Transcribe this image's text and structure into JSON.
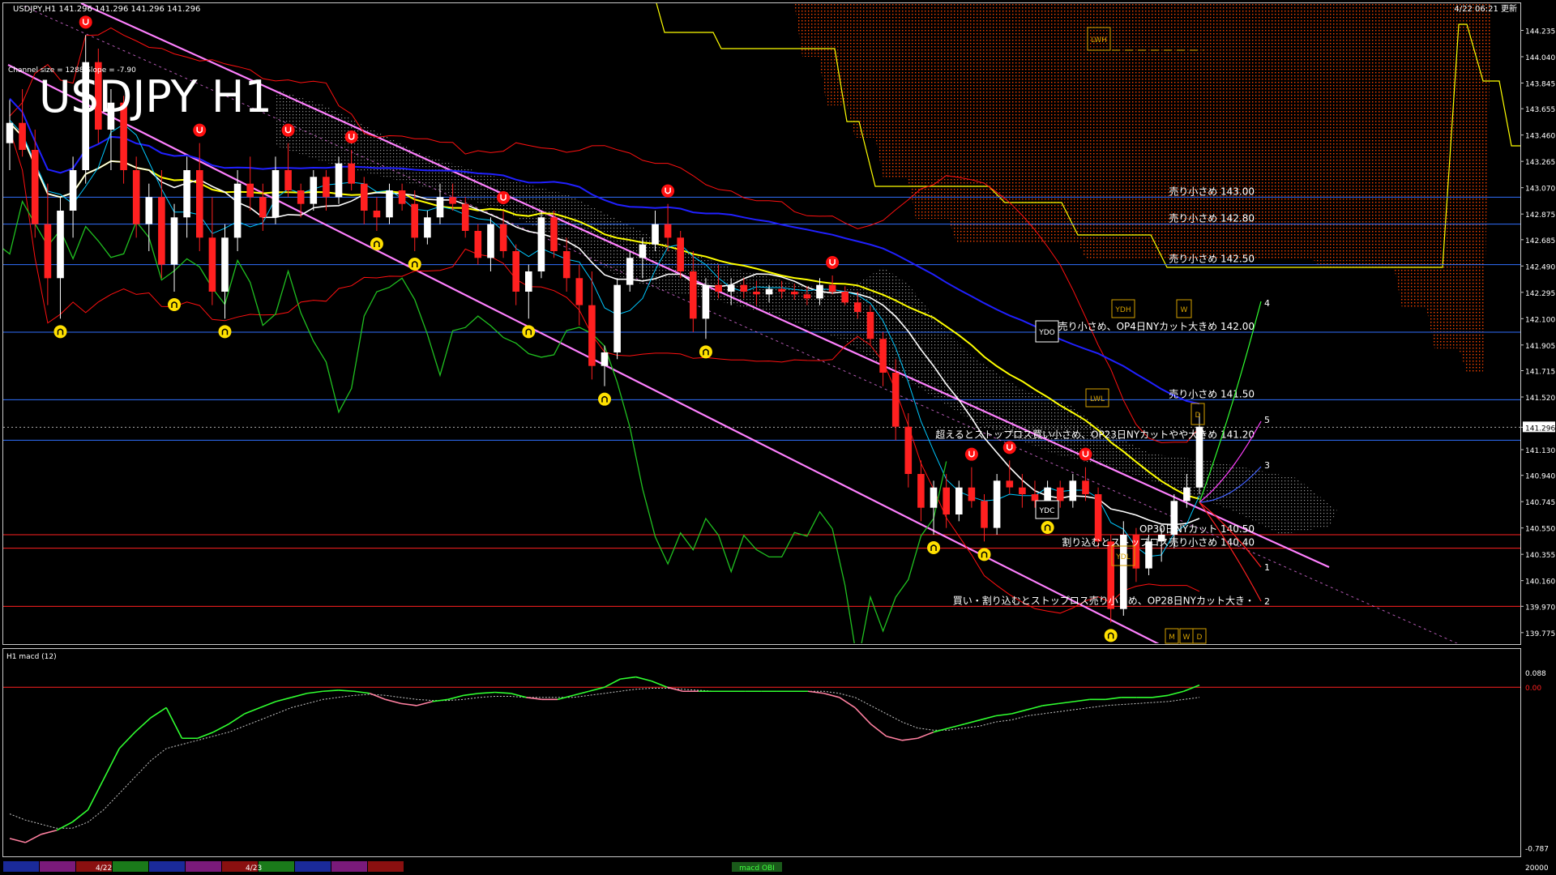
{
  "header": {
    "symbol_line": "USDJPY,H1  141.296 141.296 141.296 141.296",
    "channel_info": "Channel size = 1288 Slope = -7.90",
    "big_title": "USDJPY H1",
    "update_time": "4/22 06:21 更新"
  },
  "subwindow": {
    "label": "H1  macd (12)",
    "indicator_tag": "macd OBI"
  },
  "bottom_bar": {
    "date_labels": [
      "4/22",
      "4/23"
    ]
  },
  "colors": {
    "background": "#000000",
    "frame": "#c8c8c8",
    "bull_candle": "#ffffff",
    "bear_candle": "#ff2020",
    "channel": "#ff80ff",
    "ma_yellow": "#ffff00",
    "ma_white": "#ffffff",
    "ma_blue": "#2020ff",
    "bollinger": "#ff1010",
    "lagging_span": "#20c020",
    "cloud": "#ff4400",
    "level_blue": "#3070ff",
    "level_red": "#ff2020",
    "macd_line": "#30ff30",
    "macd_signal": "#c8c8c8"
  },
  "chart_data": {
    "type": "candlestick",
    "symbol": "USDJPY",
    "timeframe": "H1",
    "last_price": 141.296,
    "y_axis_ticks": [
      "144.235",
      "144.040",
      "143.845",
      "143.655",
      "143.460",
      "143.265",
      "143.070",
      "142.875",
      "142.685",
      "142.490",
      "142.295",
      "142.100",
      "141.905",
      "141.715",
      "141.520",
      "141.296",
      "141.130",
      "140.940",
      "140.745",
      "140.550",
      "140.355",
      "140.160",
      "139.970",
      "139.775"
    ],
    "ylim": [
      139.72,
      144.4
    ],
    "macd_axis_ticks": [
      "0.088",
      "0.00",
      "-0.787"
    ],
    "macd_scale_bottom": "20000",
    "candles": [
      {
        "o": 143.4,
        "h": 143.72,
        "l": 143.2,
        "c": 143.55
      },
      {
        "o": 143.55,
        "h": 143.8,
        "l": 143.3,
        "c": 143.35
      },
      {
        "o": 143.35,
        "h": 143.5,
        "l": 142.7,
        "c": 142.8
      },
      {
        "o": 142.8,
        "h": 143.1,
        "l": 142.2,
        "c": 142.4
      },
      {
        "o": 142.4,
        "h": 143.0,
        "l": 142.1,
        "c": 142.9
      },
      {
        "o": 142.9,
        "h": 143.3,
        "l": 142.7,
        "c": 143.2
      },
      {
        "o": 143.2,
        "h": 144.2,
        "l": 143.1,
        "c": 144.0
      },
      {
        "o": 144.0,
        "h": 144.1,
        "l": 143.4,
        "c": 143.5
      },
      {
        "o": 143.5,
        "h": 143.8,
        "l": 143.2,
        "c": 143.7
      },
      {
        "o": 143.7,
        "h": 143.75,
        "l": 143.1,
        "c": 143.2
      },
      {
        "o": 143.2,
        "h": 143.3,
        "l": 142.7,
        "c": 142.8
      },
      {
        "o": 142.8,
        "h": 143.1,
        "l": 142.6,
        "c": 143.0
      },
      {
        "o": 143.0,
        "h": 143.2,
        "l": 142.4,
        "c": 142.5
      },
      {
        "o": 142.5,
        "h": 142.95,
        "l": 142.3,
        "c": 142.85
      },
      {
        "o": 142.85,
        "h": 143.3,
        "l": 142.7,
        "c": 143.2
      },
      {
        "o": 143.2,
        "h": 143.4,
        "l": 142.6,
        "c": 142.7
      },
      {
        "o": 142.7,
        "h": 143.0,
        "l": 142.2,
        "c": 142.3
      },
      {
        "o": 142.3,
        "h": 142.8,
        "l": 142.1,
        "c": 142.7
      },
      {
        "o": 142.7,
        "h": 143.2,
        "l": 142.6,
        "c": 143.1
      },
      {
        "o": 143.1,
        "h": 143.3,
        "l": 142.9,
        "c": 143.0
      },
      {
        "o": 143.0,
        "h": 143.1,
        "l": 142.75,
        "c": 142.85
      },
      {
        "o": 142.85,
        "h": 143.3,
        "l": 142.8,
        "c": 143.2
      },
      {
        "o": 143.2,
        "h": 143.4,
        "l": 143.0,
        "c": 143.05
      },
      {
        "o": 143.05,
        "h": 143.1,
        "l": 142.85,
        "c": 142.95
      },
      {
        "o": 142.95,
        "h": 143.2,
        "l": 142.9,
        "c": 143.15
      },
      {
        "o": 143.15,
        "h": 143.2,
        "l": 142.9,
        "c": 143.0
      },
      {
        "o": 143.0,
        "h": 143.3,
        "l": 142.95,
        "c": 143.25
      },
      {
        "o": 143.25,
        "h": 143.35,
        "l": 143.05,
        "c": 143.1
      },
      {
        "o": 143.1,
        "h": 143.15,
        "l": 142.8,
        "c": 142.9
      },
      {
        "o": 142.9,
        "h": 143.0,
        "l": 142.75,
        "c": 142.85
      },
      {
        "o": 142.85,
        "h": 143.1,
        "l": 142.8,
        "c": 143.05
      },
      {
        "o": 143.05,
        "h": 143.1,
        "l": 142.9,
        "c": 142.95
      },
      {
        "o": 142.95,
        "h": 143.05,
        "l": 142.6,
        "c": 142.7
      },
      {
        "o": 142.7,
        "h": 142.9,
        "l": 142.65,
        "c": 142.85
      },
      {
        "o": 142.85,
        "h": 143.1,
        "l": 142.8,
        "c": 143.0
      },
      {
        "o": 143.0,
        "h": 143.1,
        "l": 142.9,
        "c": 142.95
      },
      {
        "o": 142.95,
        "h": 143.0,
        "l": 142.7,
        "c": 142.75
      },
      {
        "o": 142.75,
        "h": 142.8,
        "l": 142.5,
        "c": 142.55
      },
      {
        "o": 142.55,
        "h": 142.85,
        "l": 142.45,
        "c": 142.8
      },
      {
        "o": 142.8,
        "h": 142.9,
        "l": 142.55,
        "c": 142.6
      },
      {
        "o": 142.6,
        "h": 142.65,
        "l": 142.2,
        "c": 142.3
      },
      {
        "o": 142.3,
        "h": 142.5,
        "l": 142.1,
        "c": 142.45
      },
      {
        "o": 142.45,
        "h": 142.9,
        "l": 142.4,
        "c": 142.85
      },
      {
        "o": 142.85,
        "h": 142.9,
        "l": 142.55,
        "c": 142.6
      },
      {
        "o": 142.6,
        "h": 142.7,
        "l": 142.3,
        "c": 142.4
      },
      {
        "o": 142.4,
        "h": 142.5,
        "l": 142.05,
        "c": 142.2
      },
      {
        "o": 142.2,
        "h": 142.45,
        "l": 141.65,
        "c": 141.75
      },
      {
        "o": 141.75,
        "h": 141.9,
        "l": 141.6,
        "c": 141.85
      },
      {
        "o": 141.85,
        "h": 142.4,
        "l": 141.8,
        "c": 142.35
      },
      {
        "o": 142.35,
        "h": 142.6,
        "l": 142.3,
        "c": 142.55
      },
      {
        "o": 142.55,
        "h": 142.7,
        "l": 142.4,
        "c": 142.65
      },
      {
        "o": 142.65,
        "h": 142.9,
        "l": 142.6,
        "c": 142.8
      },
      {
        "o": 142.8,
        "h": 142.95,
        "l": 142.6,
        "c": 142.7
      },
      {
        "o": 142.7,
        "h": 142.75,
        "l": 142.4,
        "c": 142.45
      },
      {
        "o": 142.45,
        "h": 142.6,
        "l": 142.0,
        "c": 142.1
      },
      {
        "o": 142.1,
        "h": 142.4,
        "l": 141.95,
        "c": 142.35
      },
      {
        "o": 142.35,
        "h": 142.5,
        "l": 142.25,
        "c": 142.3
      },
      {
        "o": 142.3,
        "h": 142.4,
        "l": 142.2,
        "c": 142.35
      },
      {
        "o": 142.35,
        "h": 142.4,
        "l": 142.25,
        "c": 142.3
      },
      {
        "o": 142.3,
        "h": 142.38,
        "l": 142.2,
        "c": 142.28
      },
      {
        "o": 142.28,
        "h": 142.35,
        "l": 142.22,
        "c": 142.32
      },
      {
        "o": 142.32,
        "h": 142.38,
        "l": 142.25,
        "c": 142.3
      },
      {
        "o": 142.3,
        "h": 142.36,
        "l": 142.24,
        "c": 142.28
      },
      {
        "o": 142.28,
        "h": 142.34,
        "l": 142.2,
        "c": 142.25
      },
      {
        "o": 142.25,
        "h": 142.4,
        "l": 142.2,
        "c": 142.35
      },
      {
        "o": 142.35,
        "h": 142.42,
        "l": 142.28,
        "c": 142.3
      },
      {
        "o": 142.3,
        "h": 142.34,
        "l": 142.2,
        "c": 142.22
      },
      {
        "o": 142.22,
        "h": 142.3,
        "l": 142.1,
        "c": 142.15
      },
      {
        "o": 142.15,
        "h": 142.2,
        "l": 141.9,
        "c": 141.95
      },
      {
        "o": 141.95,
        "h": 142.0,
        "l": 141.6,
        "c": 141.7
      },
      {
        "o": 141.7,
        "h": 141.8,
        "l": 141.2,
        "c": 141.3
      },
      {
        "o": 141.3,
        "h": 141.4,
        "l": 140.85,
        "c": 140.95
      },
      {
        "o": 140.95,
        "h": 141.05,
        "l": 140.6,
        "c": 140.7
      },
      {
        "o": 140.7,
        "h": 140.9,
        "l": 140.5,
        "c": 140.85
      },
      {
        "o": 140.85,
        "h": 140.95,
        "l": 140.55,
        "c": 140.65
      },
      {
        "o": 140.65,
        "h": 140.9,
        "l": 140.6,
        "c": 140.85
      },
      {
        "o": 140.85,
        "h": 141.0,
        "l": 140.7,
        "c": 140.75
      },
      {
        "o": 140.75,
        "h": 140.8,
        "l": 140.45,
        "c": 140.55
      },
      {
        "o": 140.55,
        "h": 140.95,
        "l": 140.5,
        "c": 140.9
      },
      {
        "o": 140.9,
        "h": 141.05,
        "l": 140.8,
        "c": 140.85
      },
      {
        "o": 140.85,
        "h": 140.95,
        "l": 140.7,
        "c": 140.8
      },
      {
        "o": 140.8,
        "h": 140.9,
        "l": 140.7,
        "c": 140.75
      },
      {
        "o": 140.75,
        "h": 140.9,
        "l": 140.65,
        "c": 140.85
      },
      {
        "o": 140.85,
        "h": 140.9,
        "l": 140.7,
        "c": 140.75
      },
      {
        "o": 140.75,
        "h": 140.95,
        "l": 140.7,
        "c": 140.9
      },
      {
        "o": 140.9,
        "h": 141.0,
        "l": 140.75,
        "c": 140.8
      },
      {
        "o": 140.8,
        "h": 140.85,
        "l": 140.4,
        "c": 140.45
      },
      {
        "o": 140.45,
        "h": 140.5,
        "l": 139.85,
        "c": 139.95
      },
      {
        "o": 139.95,
        "h": 140.6,
        "l": 139.9,
        "c": 140.5
      },
      {
        "o": 140.5,
        "h": 140.55,
        "l": 140.15,
        "c": 140.25
      },
      {
        "o": 140.25,
        "h": 140.5,
        "l": 140.2,
        "c": 140.45
      },
      {
        "o": 140.45,
        "h": 140.55,
        "l": 140.3,
        "c": 140.5
      },
      {
        "o": 140.5,
        "h": 140.8,
        "l": 140.4,
        "c": 140.75
      },
      {
        "o": 140.75,
        "h": 140.95,
        "l": 140.7,
        "c": 140.85
      },
      {
        "o": 140.85,
        "h": 141.4,
        "l": 140.8,
        "c": 141.3
      }
    ],
    "horizontal_levels": [
      {
        "price": 143.0,
        "color": "blue",
        "label": "売り小さめ 143.00"
      },
      {
        "price": 142.8,
        "color": "blue",
        "label": "売り小さめ 142.80"
      },
      {
        "price": 142.5,
        "color": "blue",
        "label": "売り小さめ 142.50"
      },
      {
        "price": 142.0,
        "color": "blue",
        "label": "売り小さめ、OP4日NYカット大きめ 142.00"
      },
      {
        "price": 141.5,
        "color": "blue",
        "label": "売り小さめ 141.50"
      },
      {
        "price": 141.2,
        "color": "blue",
        "label": "超えるとストップロス買い小さめ、OP23日NYカットやや大きめ 141.20"
      },
      {
        "price": 140.5,
        "color": "red",
        "label": "OP30日NYカット 140.50"
      },
      {
        "price": 140.4,
        "color": "red",
        "label": "割り込むとストップロス売り小さめ 140.40"
      },
      {
        "price": 139.97,
        "color": "red",
        "label": "買い・割り込むとストップロス売り小さめ、OP28日NYカット大き・"
      }
    ],
    "boxes": [
      "LWH",
      "YDH",
      "W",
      "YDO",
      "LWL",
      "D",
      "YDC",
      "YDL",
      "M",
      "W",
      "D"
    ],
    "projection_labels": [
      "4",
      "5",
      "3",
      "1",
      "2"
    ],
    "macd": {
      "main": [
        -0.74,
        -0.76,
        -0.72,
        -0.7,
        -0.66,
        -0.6,
        -0.45,
        -0.3,
        -0.22,
        -0.15,
        -0.1,
        -0.25,
        -0.25,
        -0.22,
        -0.18,
        -0.13,
        -0.1,
        -0.07,
        -0.05,
        -0.03,
        -0.02,
        -0.015,
        -0.02,
        -0.03,
        -0.06,
        -0.08,
        -0.09,
        -0.07,
        -0.06,
        -0.04,
        -0.03,
        -0.025,
        -0.03,
        -0.05,
        -0.06,
        -0.06,
        -0.04,
        -0.02,
        0.0,
        0.04,
        0.05,
        0.03,
        0.0,
        -0.02,
        -0.02,
        -0.02,
        -0.02,
        -0.02,
        -0.02,
        -0.02,
        -0.02,
        -0.02,
        -0.03,
        -0.05,
        -0.1,
        -0.18,
        -0.24,
        -0.26,
        -0.25,
        -0.22,
        -0.2,
        -0.18,
        -0.16,
        -0.14,
        -0.13,
        -0.11,
        -0.09,
        -0.08,
        -0.07,
        -0.06,
        -0.06,
        -0.05,
        -0.05,
        -0.05,
        -0.04,
        -0.02,
        0.01
      ],
      "signal": [
        -0.62,
        -0.65,
        -0.67,
        -0.69,
        -0.69,
        -0.66,
        -0.6,
        -0.52,
        -0.44,
        -0.36,
        -0.3,
        -0.28,
        -0.26,
        -0.24,
        -0.22,
        -0.19,
        -0.16,
        -0.13,
        -0.1,
        -0.08,
        -0.06,
        -0.05,
        -0.04,
        -0.035,
        -0.04,
        -0.05,
        -0.06,
        -0.065,
        -0.065,
        -0.06,
        -0.05,
        -0.045,
        -0.045,
        -0.05,
        -0.05,
        -0.05,
        -0.05,
        -0.04,
        -0.03,
        -0.02,
        -0.01,
        -0.005,
        -0.005,
        -0.01,
        -0.015,
        -0.02,
        -0.02,
        -0.02,
        -0.02,
        -0.02,
        -0.02,
        -0.02,
        -0.02,
        -0.03,
        -0.05,
        -0.09,
        -0.13,
        -0.17,
        -0.2,
        -0.21,
        -0.21,
        -0.2,
        -0.19,
        -0.17,
        -0.16,
        -0.14,
        -0.13,
        -0.12,
        -0.11,
        -0.1,
        -0.09,
        -0.085,
        -0.08,
        -0.075,
        -0.07,
        -0.06,
        -0.05
      ]
    }
  }
}
